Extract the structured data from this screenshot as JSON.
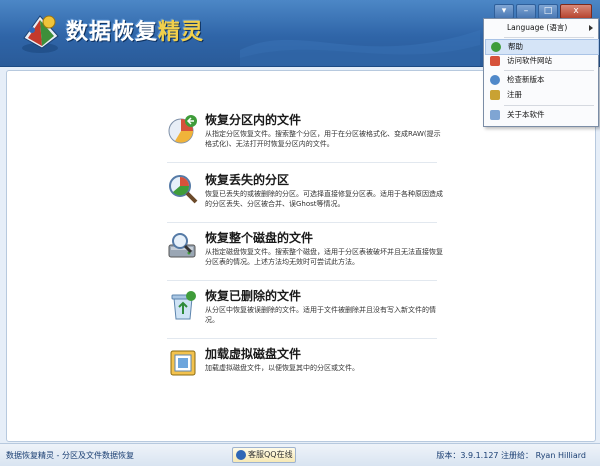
{
  "header": {
    "title_part1": "数据恢复",
    "title_part2": "精灵"
  },
  "window_buttons": {
    "menu": "▾",
    "minimize": "–",
    "maximize": "□",
    "close": "x"
  },
  "options": [
    {
      "title": "恢复分区内的文件",
      "desc": "从指定分区恢复文件。搜索整个分区，用于在分区被格式化、变成RAW(提示格式化)、无法打开时恢复分区内的文件。",
      "icon": "partition-pie-icon"
    },
    {
      "title": "恢复丢失的分区",
      "desc": "恢复已丢失的或被删除的分区。可选择直接修复分区表。适用于各种原因造成的分区丢失、分区被合并、误Ghost等情况。",
      "icon": "magnifier-partition-icon"
    },
    {
      "title": "恢复整个磁盘的文件",
      "desc": "从指定磁盘恢复文件。搜索整个磁盘，适用于分区表被破坏并且无法直接恢复分区表的情况。上述方法均无效时可尝试此方法。",
      "icon": "disk-search-icon"
    },
    {
      "title": "恢复已删除的文件",
      "desc": "从分区中恢复被误删除的文件。适用于文件被删除并且没有写入新文件的情况。",
      "icon": "recycle-bin-icon"
    },
    {
      "title": "加载虚拟磁盘文件",
      "desc": "加载虚拟磁盘文件，以便恢复其中的分区或文件。",
      "icon": "virtual-disk-icon"
    }
  ],
  "status": {
    "left": "数据恢复精灵 - 分区及文件数据恢复",
    "qq": "客服QQ在线",
    "right": "版本：3.9.1.127 注册给： Ryan Hilliard"
  },
  "menu": {
    "items": [
      {
        "label": "Language (语言)",
        "icon": "",
        "submenu": true
      },
      {
        "label": "帮助",
        "icon": "help-icon",
        "selected": true
      },
      {
        "label": "访问软件网站",
        "icon": "home-icon"
      },
      {
        "label": "检查新版本",
        "icon": "globe-update-icon"
      },
      {
        "label": "注册",
        "icon": "lock-icon"
      },
      {
        "label": "关于本软件",
        "icon": "about-icon"
      }
    ]
  }
}
